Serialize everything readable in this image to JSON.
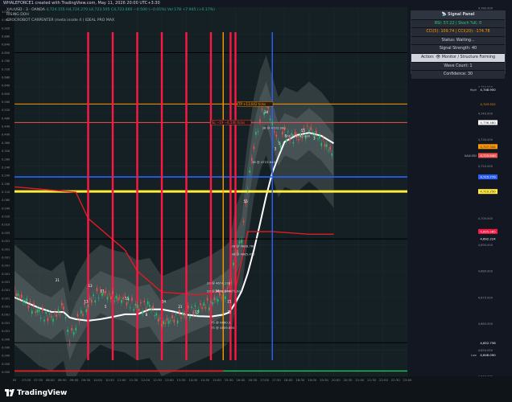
{
  "header": {
    "watermark_text": "WHALEFORCE1 created with TradingView.com, May 11, 2026 20:00 UTC+3:30"
  },
  "legend": {
    "symbol": "XAUUSD · 3 · OANDA",
    "ohlc": "4,724.155  H4,724.270  L4,723.505  C4,723.660  −0.500 (−0.01%)",
    "volume": "Vol 178  +7.945 (+0.17%)",
    "line2": "RISING DOH",
    "line3": "CROCROBOT CARPENTER (meta inside 4 ) IDEAL PRO MAX"
  },
  "signal_panel": {
    "title": "📡 Signal Panel",
    "rsi_line": "RSI: 57.22 | Stoch %K: 0",
    "cci_line": "CCI(5): 109.74 | CCI(20): -174.78",
    "status": "Status: Waiting...",
    "strength": "Signal Strength: 40",
    "action": "Action: 👁 Monitor / Structure Forming",
    "wave": "Wave Count: 1",
    "confidence": "Confidence: 30"
  },
  "left_axis_ticks": [
    "1.000",
    "0.960",
    "0.920",
    "0.880",
    "0.840",
    "0.800",
    "0.760",
    "0.720",
    "0.680",
    "0.640",
    "0.600",
    "0.560",
    "0.520",
    "0.480",
    "0.440",
    "0.400",
    "0.360",
    "0.320",
    "0.280",
    "0.240",
    "0.200",
    "0.160",
    "0.120",
    "0.080",
    "0.040",
    "0.020",
    "0.010",
    "0.005",
    "0.001",
    "0.001",
    "0.001",
    "0.001",
    "0.001",
    "0.001",
    "0.001",
    "0.001",
    "0.001",
    "0.001",
    "0.001",
    "0.001",
    "0.000",
    "0.000",
    "0.000",
    "0.000",
    "0.000"
  ],
  "x_axis_ticks": [
    "05",
    "07:00",
    "07:30",
    "08:00",
    "08:30",
    "09:00",
    "09:30",
    "10:00",
    "10:30",
    "11:00",
    "11:30",
    "12:00",
    "12:30",
    "13:00",
    "13:30",
    "14:00",
    "14:30",
    "15:00",
    "15:30",
    "16:00",
    "16:30",
    "17:00",
    "17:30",
    "18:00",
    "18:30",
    "19:00",
    "19:30",
    "20:00",
    "20:30",
    "21:00",
    "21:30",
    "22:00",
    "22:30",
    "23:00"
  ],
  "right_axis": {
    "ticks": [
      "4,780.000",
      "4,770.000",
      "4,760.000",
      "4,750.000",
      "4,740.000",
      "4,730.000",
      "4,720.000",
      "4,710.000",
      "4,700.000",
      "4,690.000",
      "4,680.000",
      "4,670.000",
      "4,660.000",
      "4,650.000",
      "4,640.000"
    ],
    "tags": [
      {
        "text": "4,763.047",
        "color": "#131722",
        "fg": "#ffffff"
      },
      {
        "text": "4,748.950",
        "color": "#131722",
        "fg": "#ffffff",
        "prefix": "High"
      },
      {
        "text": "4,743.522",
        "color": "#131722",
        "fg": "#ff9800"
      },
      {
        "text": "4,736.480",
        "color": "#ffffff",
        "fg": "#131722"
      },
      {
        "text": "4,727.344",
        "color": "#ff9800",
        "fg": "#131722"
      },
      {
        "text": "4,723.940",
        "color": "#ef5350",
        "fg": "#ffffff",
        "prefix": "XAUUSD"
      },
      {
        "text": "4,715.779",
        "color": "#2962ff",
        "fg": "#ffffff"
      },
      {
        "text": "4,710.250",
        "color": "#ffeb3b",
        "fg": "#131722"
      },
      {
        "text": "4,695.065",
        "color": "#ff1744",
        "fg": "#ffffff"
      },
      {
        "text": "4,692.224",
        "color": "#131722",
        "fg": "#ffffff"
      },
      {
        "text": "4,652.758",
        "color": "#131722",
        "fg": "#ffffff"
      },
      {
        "text": "4,648.090",
        "color": "#131722",
        "fg": "#ffffff",
        "prefix": "Low"
      }
    ]
  },
  "chart_annotations": {
    "tp_label": "TP +13.042 ticks",
    "tp_prefix": "TP",
    "sl_label": "−6.540 ticks",
    "sl_prefix": "SL",
    "sl_value": "−19",
    "labels_38": [
      "38 @ 4733.940",
      "38 @ 4730.480",
      "38 @ 4723.640",
      "38 @ 4688.760",
      "38 @ 4685.490",
      "38 @ 4671.630"
    ],
    "labels_20": [
      "20 @ 4674.130",
      "20 @ 4671.240"
    ],
    "labels_75": [
      "75 @ 4660.3",
      "75 @ 4659.890"
    ],
    "small_numbers": [
      "21",
      "13",
      "21",
      "55",
      "34",
      "21",
      "13",
      "55",
      "8",
      "5",
      "3",
      "21",
      "34",
      "55",
      "3",
      "34",
      "75",
      "13",
      "5",
      "8"
    ]
  },
  "chart_data": {
    "type": "line",
    "symbol": "XAUUSD",
    "interval": "3",
    "x_range": [
      "07:00",
      "23:00"
    ],
    "ylim": [
      4640,
      4780
    ],
    "price_close_path": [
      [
        "07:00",
        4672
      ],
      [
        "07:30",
        4668
      ],
      [
        "08:00",
        4664
      ],
      [
        "08:30",
        4662
      ],
      [
        "09:00",
        4666
      ],
      [
        "09:15",
        4654
      ],
      [
        "09:30",
        4660
      ],
      [
        "10:00",
        4668
      ],
      [
        "10:30",
        4672
      ],
      [
        "11:00",
        4670
      ],
      [
        "11:30",
        4669
      ],
      [
        "12:00",
        4666
      ],
      [
        "12:30",
        4667
      ],
      [
        "13:00",
        4660
      ],
      [
        "13:30",
        4662
      ],
      [
        "14:00",
        4664
      ],
      [
        "14:30",
        4666
      ],
      [
        "15:00",
        4668
      ],
      [
        "15:30",
        4671
      ],
      [
        "15:45",
        4673
      ],
      [
        "16:00",
        4686
      ],
      [
        "16:15",
        4692
      ],
      [
        "16:30",
        4712
      ],
      [
        "16:45",
        4728
      ],
      [
        "17:00",
        4738
      ],
      [
        "17:15",
        4744
      ],
      [
        "17:30",
        4736
      ],
      [
        "17:45",
        4728
      ],
      [
        "18:00",
        4732
      ],
      [
        "18:30",
        4730
      ],
      [
        "19:00",
        4734
      ],
      [
        "19:30",
        4730
      ],
      [
        "20:00",
        4724
      ]
    ],
    "horizontal_levels": [
      {
        "price": 4763.047,
        "color": "#000000"
      },
      {
        "price": 4743.522,
        "color": "#ff9800"
      },
      {
        "price": 4736.48,
        "color": "#ef5350"
      },
      {
        "price": 4715.779,
        "color": "#2962ff"
      },
      {
        "price": 4710.25,
        "color": "#ffeb3b"
      },
      {
        "price": 4692.224,
        "color": "#000000"
      },
      {
        "price": 4652.758,
        "color": "#000000"
      }
    ],
    "vertical_markers": [
      {
        "time": "10:00",
        "color": "#ff1744"
      },
      {
        "time": "11:00",
        "color": "#ff1744"
      },
      {
        "time": "12:00",
        "color": "#ff1744"
      },
      {
        "time": "13:00",
        "color": "#ff1744"
      },
      {
        "time": "14:00",
        "color": "#ff1744"
      },
      {
        "time": "15:00",
        "color": "#ff1744"
      },
      {
        "time": "15:30",
        "color": "#ff9800"
      },
      {
        "time": "15:48",
        "color": "#ff1744"
      },
      {
        "time": "16:00",
        "color": "#ff1744"
      },
      {
        "time": "17:30",
        "color": "#2962ff"
      }
    ]
  }
}
